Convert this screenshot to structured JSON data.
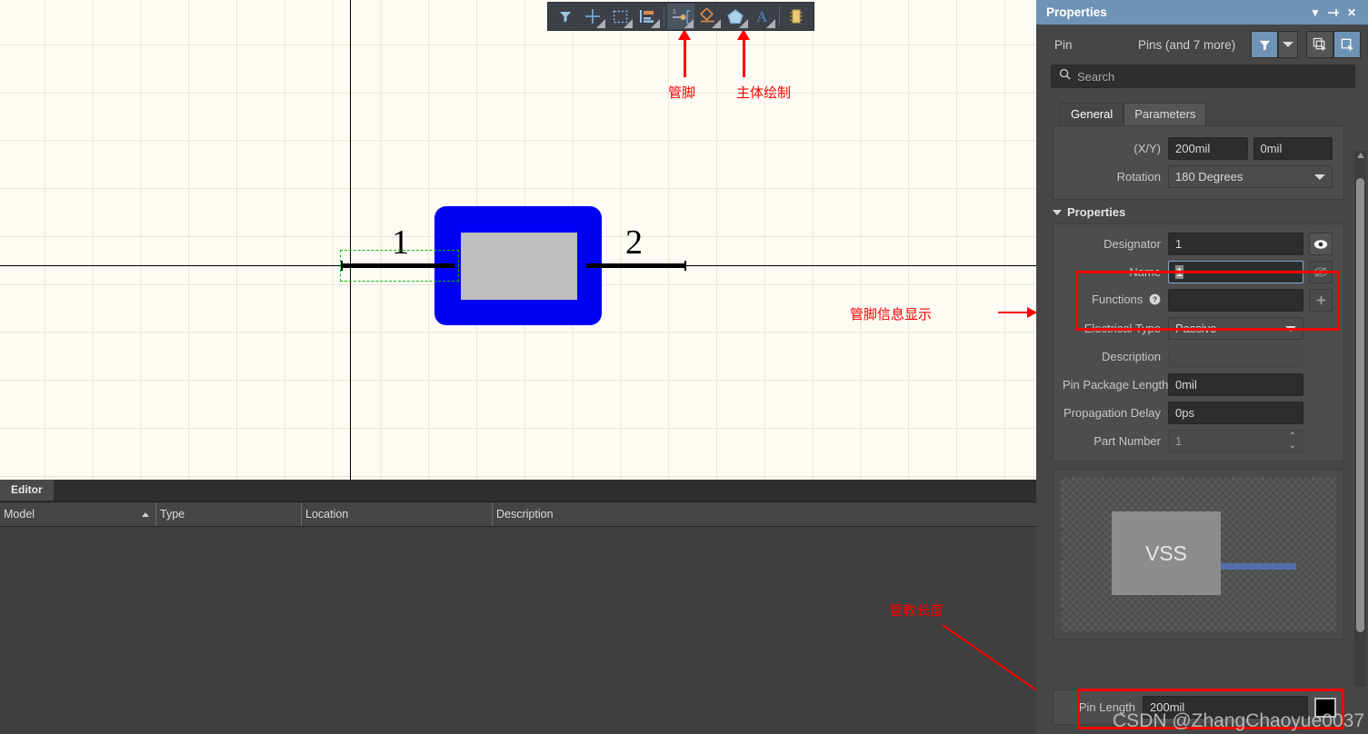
{
  "toolbar": {
    "items": [
      {
        "name": "filter-icon",
        "label": "Filter"
      },
      {
        "name": "crosshair-icon",
        "label": "Place Crosshair"
      },
      {
        "name": "selection-rect-icon",
        "label": "Rectangular Select"
      },
      {
        "name": "align-icon",
        "label": "Align"
      },
      {
        "name": "place-pin-icon",
        "label": "Place Pin"
      },
      {
        "name": "place-line-icon",
        "label": "Place Line"
      },
      {
        "name": "place-polygon-icon",
        "label": "Place Polygon"
      },
      {
        "name": "place-text-icon",
        "label": "Place Text"
      },
      {
        "name": "place-ic-icon",
        "label": "Place IC"
      }
    ]
  },
  "canvas": {
    "pin1_number": "1",
    "pin2_number": "2",
    "annotations": [
      {
        "name": "annotation-pin",
        "text": "管脚"
      },
      {
        "name": "annotation-body-draw",
        "text": "主体绘制"
      },
      {
        "name": "annotation-pin-info",
        "text": "管脚信息显示"
      },
      {
        "name": "annotation-pin-length",
        "text": "管教长度"
      }
    ]
  },
  "editor": {
    "tab_label": "Editor",
    "columns": [
      "Model",
      "Type",
      "Location",
      "Description"
    ],
    "rows": []
  },
  "properties": {
    "title": "Properties",
    "title_icons": [
      {
        "name": "panel-menu-icon",
        "glyph": "▼"
      },
      {
        "name": "panel-pin-icon",
        "glyph": "⊣"
      },
      {
        "name": "panel-close-icon",
        "glyph": "✕"
      }
    ],
    "object_kind": "Pin",
    "object_count": "Pins (and 7 more)",
    "search": {
      "value": "",
      "placeholder": "Search"
    },
    "tabs": [
      {
        "label": "General",
        "selected": true
      },
      {
        "label": "Parameters",
        "selected": false
      }
    ],
    "location": {
      "label": "(X/Y)",
      "x": "200mil",
      "y": "0mil"
    },
    "rotation": {
      "label": "Rotation",
      "value": "180 Degrees"
    },
    "section_title": "Properties",
    "fields": {
      "designator": {
        "label": "Designator",
        "value": "1"
      },
      "name": {
        "label": "Name",
        "value": "1"
      },
      "functions": {
        "label": "Functions",
        "value": ""
      },
      "electrical_type": {
        "label": "Electrical Type",
        "value": "Passive"
      },
      "description": {
        "label": "Description",
        "value": ""
      },
      "pin_package_length": {
        "label": "Pin Package Length",
        "value": "0mil"
      },
      "propagation_delay": {
        "label": "Propagation Delay",
        "value": "0ps"
      },
      "part_number": {
        "label": "Part Number",
        "value": "1"
      },
      "pin_length": {
        "label": "Pin Length",
        "value": "200mil"
      }
    },
    "preview": {
      "symbol_text": "VSS"
    },
    "colors": {
      "title_bar": "#6f93b5",
      "accent": "#6f93b5",
      "highlight": "#ff0000",
      "panel_bg": "#464646",
      "canvas_bg": "#fdfbf4",
      "component_body": "#0000f5",
      "component_fill": "#bfbfbf"
    }
  },
  "watermark": "CSDN @ZhangChaoyue0037"
}
